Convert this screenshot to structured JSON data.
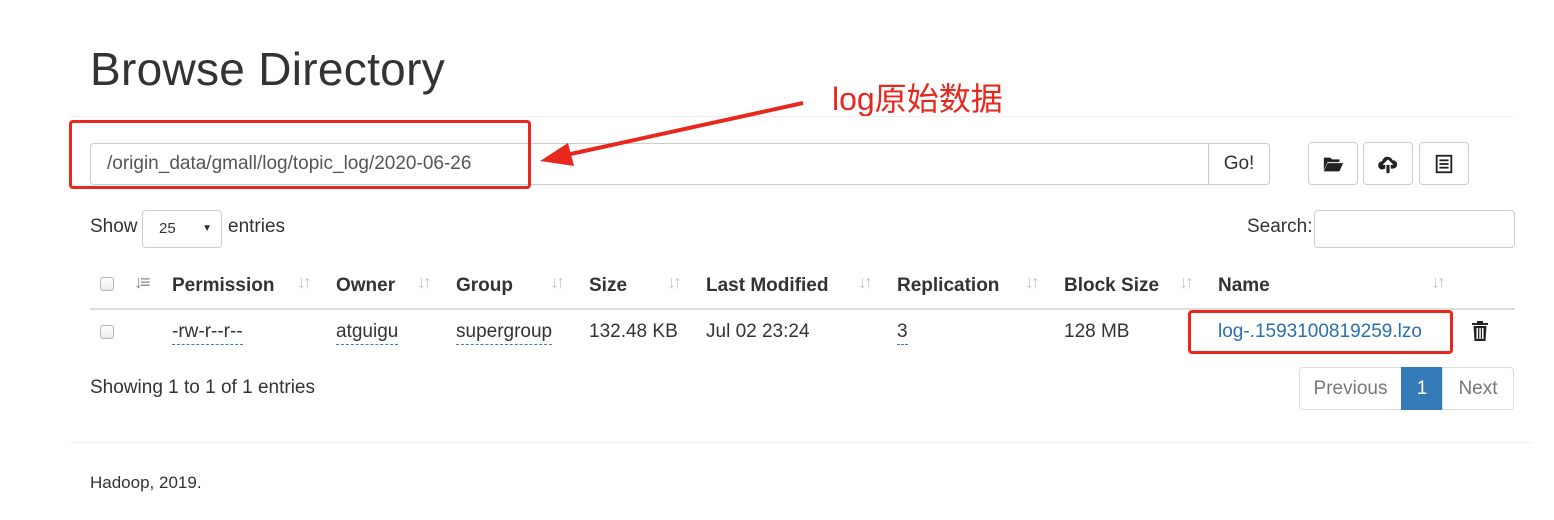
{
  "page": {
    "title": "Browse Directory"
  },
  "annotation": {
    "label": "log原始数据",
    "color": "#e8281e"
  },
  "path_bar": {
    "value": "/origin_data/gmall/log/topic_log/2020-06-26",
    "go_label": "Go!"
  },
  "toolbar": {
    "icons": [
      "folder-open-icon",
      "cloud-upload-icon",
      "list-icon"
    ]
  },
  "table_controls": {
    "show_label": "Show",
    "page_length": "25",
    "entries_label": "entries",
    "search_label": "Search:"
  },
  "table": {
    "columns": [
      "Permission",
      "Owner",
      "Group",
      "Size",
      "Last Modified",
      "Replication",
      "Block Size",
      "Name"
    ],
    "rows": [
      {
        "permission": "-rw-r--r--",
        "owner": "atguigu",
        "group": "supergroup",
        "size": "132.48 KB",
        "last_modified": "Jul 02 23:24",
        "replication": "3",
        "block_size": "128 MB",
        "name": "log-.1593100819259.lzo"
      }
    ]
  },
  "pagination": {
    "info": "Showing 1 to 1 of 1 entries",
    "previous": "Previous",
    "current": "1",
    "next": "Next",
    "active_color": "#337ab7"
  },
  "footer": {
    "text": "Hadoop, 2019."
  },
  "colors": {
    "link": "#2a6fb0",
    "highlight": "#e8281e"
  }
}
